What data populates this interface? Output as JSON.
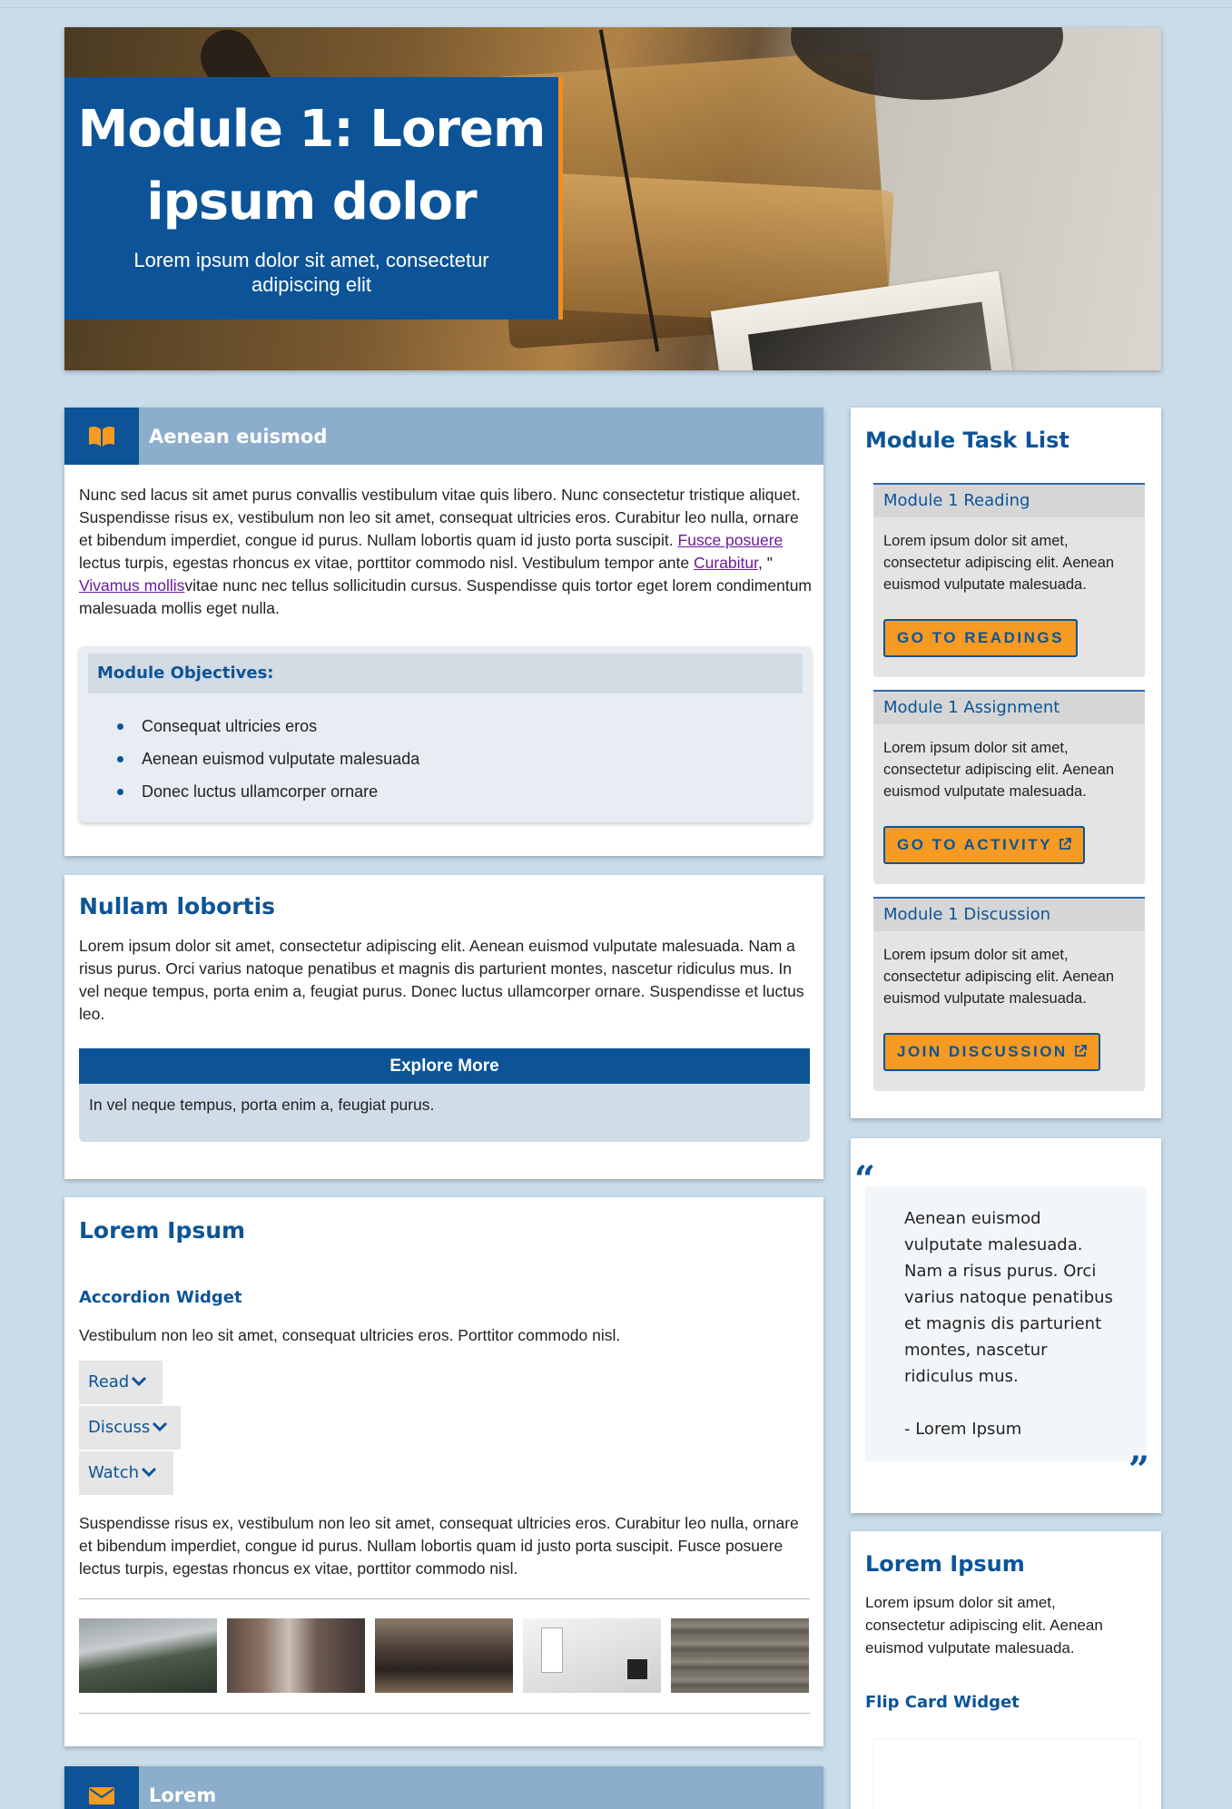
{
  "hero": {
    "title": "Module 1: Lorem ipsum dolor",
    "subtitle": "Lorem ipsum dolor sit amet, consectetur adipiscing elit"
  },
  "intro_card": {
    "banner_title": "Aenean euismod",
    "banner_icon": "book-open-icon",
    "paragraph_part1": "Nunc sed lacus sit amet purus convallis vestibulum vitae quis libero. Nunc consectetur tristique aliquet. Suspendisse risus ex, vestibulum non leo sit amet, consequat ultricies eros. Curabitur leo nulla, ornare et bibendum imperdiet, congue id purus. Nullam lobortis quam id justo porta suscipit. ",
    "link1": "Fusce posuere",
    "paragraph_part2": " lectus turpis, egestas rhoncus ex vitae, porttitor commodo nisl. Vestibulum tempor ante ",
    "link2": "Curabitur",
    "paragraph_part3": ", \" ",
    "link3": "Vivamus mollis",
    "paragraph_part4": "vitae nunc nec tellus sollicitudin cursus. Suspendisse quis tortor eget lorem condimentum malesuada mollis eget nulla.",
    "objectives_title": "Module Objectives:",
    "objectives": [
      "Consequat ultricies eros",
      "Aenean euismod vulputate malesuada",
      "Donec luctus ullamcorper ornare"
    ]
  },
  "nullam_card": {
    "title": "Nullam lobortis",
    "paragraph": "Lorem ipsum dolor sit amet, consectetur adipiscing elit. Aenean euismod vulputate malesuada. Nam a risus purus. Orci varius natoque penatibus et magnis dis parturient montes, nascetur ridiculus mus. In vel neque tempus, porta enim a, feugiat purus. Donec luctus ullamcorper ornare. Suspendisse et luctus leo.",
    "explore_title": "Explore More",
    "explore_text": "In vel neque tempus, porta enim a, feugiat purus."
  },
  "lorem_card": {
    "title": "Lorem Ipsum",
    "widget_title": "Accordion Widget",
    "widget_text": "Vestibulum non leo sit amet, consequat ultricies eros. Porttitor commodo nisl.",
    "accordion": [
      "Read",
      "Discuss",
      "Watch"
    ],
    "paragraph": "Suspendisse risus ex, vestibulum non leo sit amet, consequat ultricies eros. Curabitur leo nulla, ornare et bibendum imperdiet, congue id purus. Nullam lobortis quam id justo porta suscipit. Fusce posuere lectus turpis, egestas rhoncus ex vitae, porttitor commodo nisl."
  },
  "bottom_card": {
    "banner_title": "Lorem",
    "banner_icon": "envelope-icon"
  },
  "tasks": {
    "title": "Module Task List",
    "items": [
      {
        "title": "Module 1 Reading",
        "text": "Lorem ipsum dolor sit amet, consectetur adipiscing elit. Aenean euismod vulputate malesuada.",
        "button": "GO TO READINGS"
      },
      {
        "title": "Module 1 Assignment",
        "text": "Lorem ipsum dolor sit amet, consectetur adipiscing elit. Aenean euismod vulputate malesuada.",
        "button": "GO TO ACTIVITY"
      },
      {
        "title": "Module 1 Discussion",
        "text": "Lorem ipsum dolor sit amet, consectetur adipiscing elit. Aenean euismod vulputate malesuada.",
        "button": "JOIN DISCUSSION"
      }
    ]
  },
  "quote": {
    "text": "Aenean euismod vulputate malesuada. Nam a risus purus. Orci varius natoque penatibus et magnis dis parturient montes, nascetur ridiculus mus.",
    "author": "- Lorem Ipsum"
  },
  "side_lorem": {
    "title": "Lorem Ipsum",
    "text": "Lorem ipsum dolor sit amet, consectetur adipiscing elit. Aenean euismod vulputate malesuada.",
    "widget_title": "Flip Card Widget"
  },
  "colors": {
    "brand_blue": "#0c5497",
    "accent_orange": "#f59a23",
    "banner_blue": "#8dadcd",
    "page_bg": "#c9dcea"
  }
}
